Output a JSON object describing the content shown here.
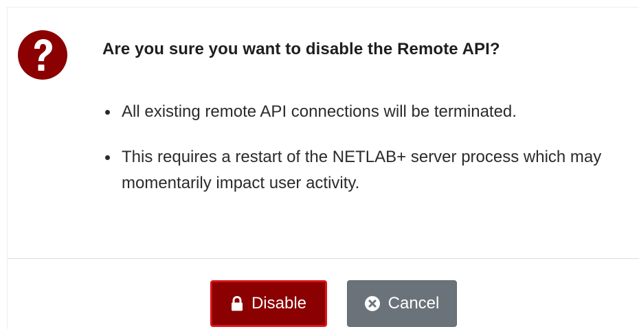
{
  "dialog": {
    "title": "Are you sure you want to disable the Remote API?",
    "icon": "question-circle-icon",
    "bullets": [
      "All existing remote API connections will be terminated.",
      "This requires a restart of the NETLAB+ server process which may momentarily impact user activity."
    ]
  },
  "buttons": {
    "disable": {
      "label": "Disable",
      "icon": "lock-icon"
    },
    "cancel": {
      "label": "Cancel",
      "icon": "times-circle-icon"
    }
  },
  "colors": {
    "icon_red": "#8b0000",
    "disable_bg": "#8b0000",
    "disable_border": "#d9121a",
    "cancel_bg": "#6b737a"
  }
}
